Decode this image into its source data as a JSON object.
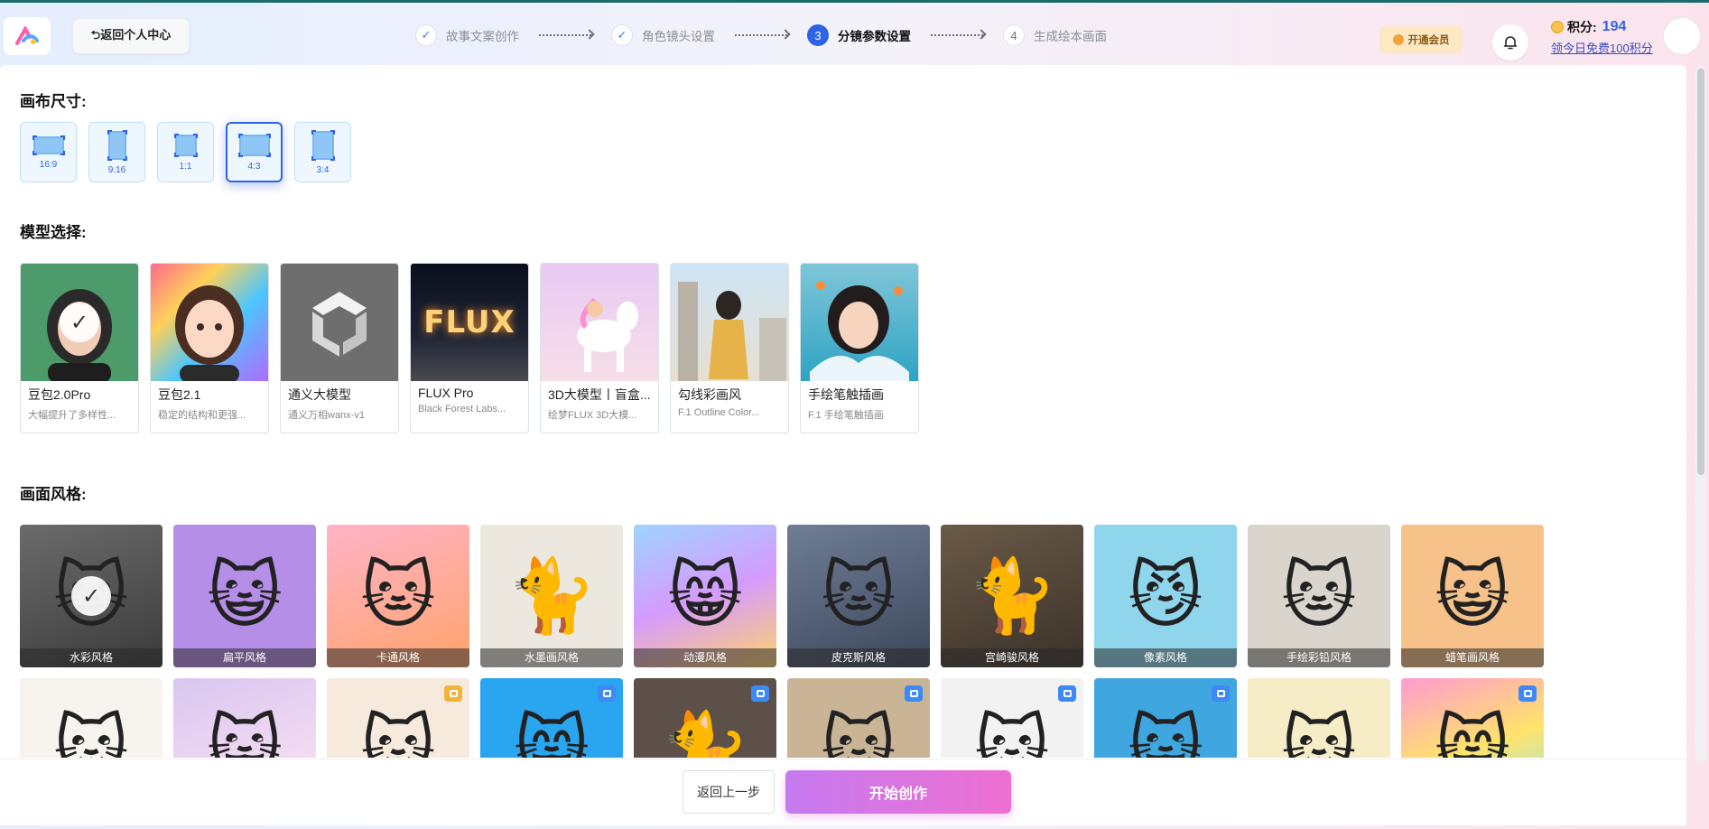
{
  "header": {
    "back_label": "⮌返回个人中心",
    "steps": [
      {
        "num": "✓",
        "label": "故事文案创作"
      },
      {
        "num": "✓",
        "label": "角色镜头设置"
      },
      {
        "num": "3",
        "label": "分镜参数设置"
      },
      {
        "num": "4",
        "label": "生成绘本画面"
      }
    ],
    "vip_label": "开通会员",
    "points_label": "积分:",
    "points_value": "194",
    "free_points_link": "领今日免费100积分"
  },
  "canvas_section": {
    "title": "画布尺寸:",
    "ratios": [
      "16:9",
      "9:16",
      "1:1",
      "4:3",
      "3:4"
    ],
    "selected": "4:3"
  },
  "model_section": {
    "title": "模型选择:",
    "models": [
      {
        "name": "豆包2.0Pro",
        "desc": "大幅提升了多样性..."
      },
      {
        "name": "豆包2.1",
        "desc": "稳定的结构和更强..."
      },
      {
        "name": "通义大模型",
        "desc": "通义万相wanx-v1"
      },
      {
        "name": "FLUX Pro",
        "desc": "Black Forest Labs...",
        "image_text": "FLUX"
      },
      {
        "name": "3D大模型丨盲盒...",
        "desc": "绘梦FLUX 3D大模..."
      },
      {
        "name": "勾线彩画风",
        "desc": "F.1 Outline Color..."
      },
      {
        "name": "手绘笔触插画",
        "desc": "F.1 手绘笔触插画"
      }
    ],
    "selected": "豆包2.0Pro"
  },
  "style_section": {
    "title": "画面风格:",
    "styles": [
      "水彩风格",
      "扁平风格",
      "卡通风格",
      "水墨画风格",
      "动漫风格",
      "皮克斯风格",
      "宫崎骏风格",
      "像素风格",
      "手绘彩铅风格",
      "蜡笔画风格"
    ],
    "selected": "水彩风格",
    "row2_count": 10
  },
  "footer": {
    "prev_label": "返回上一步",
    "start_label": "开始创作"
  },
  "colors": {
    "accent": "#2f63e6",
    "start_gradient_from": "#c57af0",
    "start_gradient_to": "#ee6fd0"
  }
}
